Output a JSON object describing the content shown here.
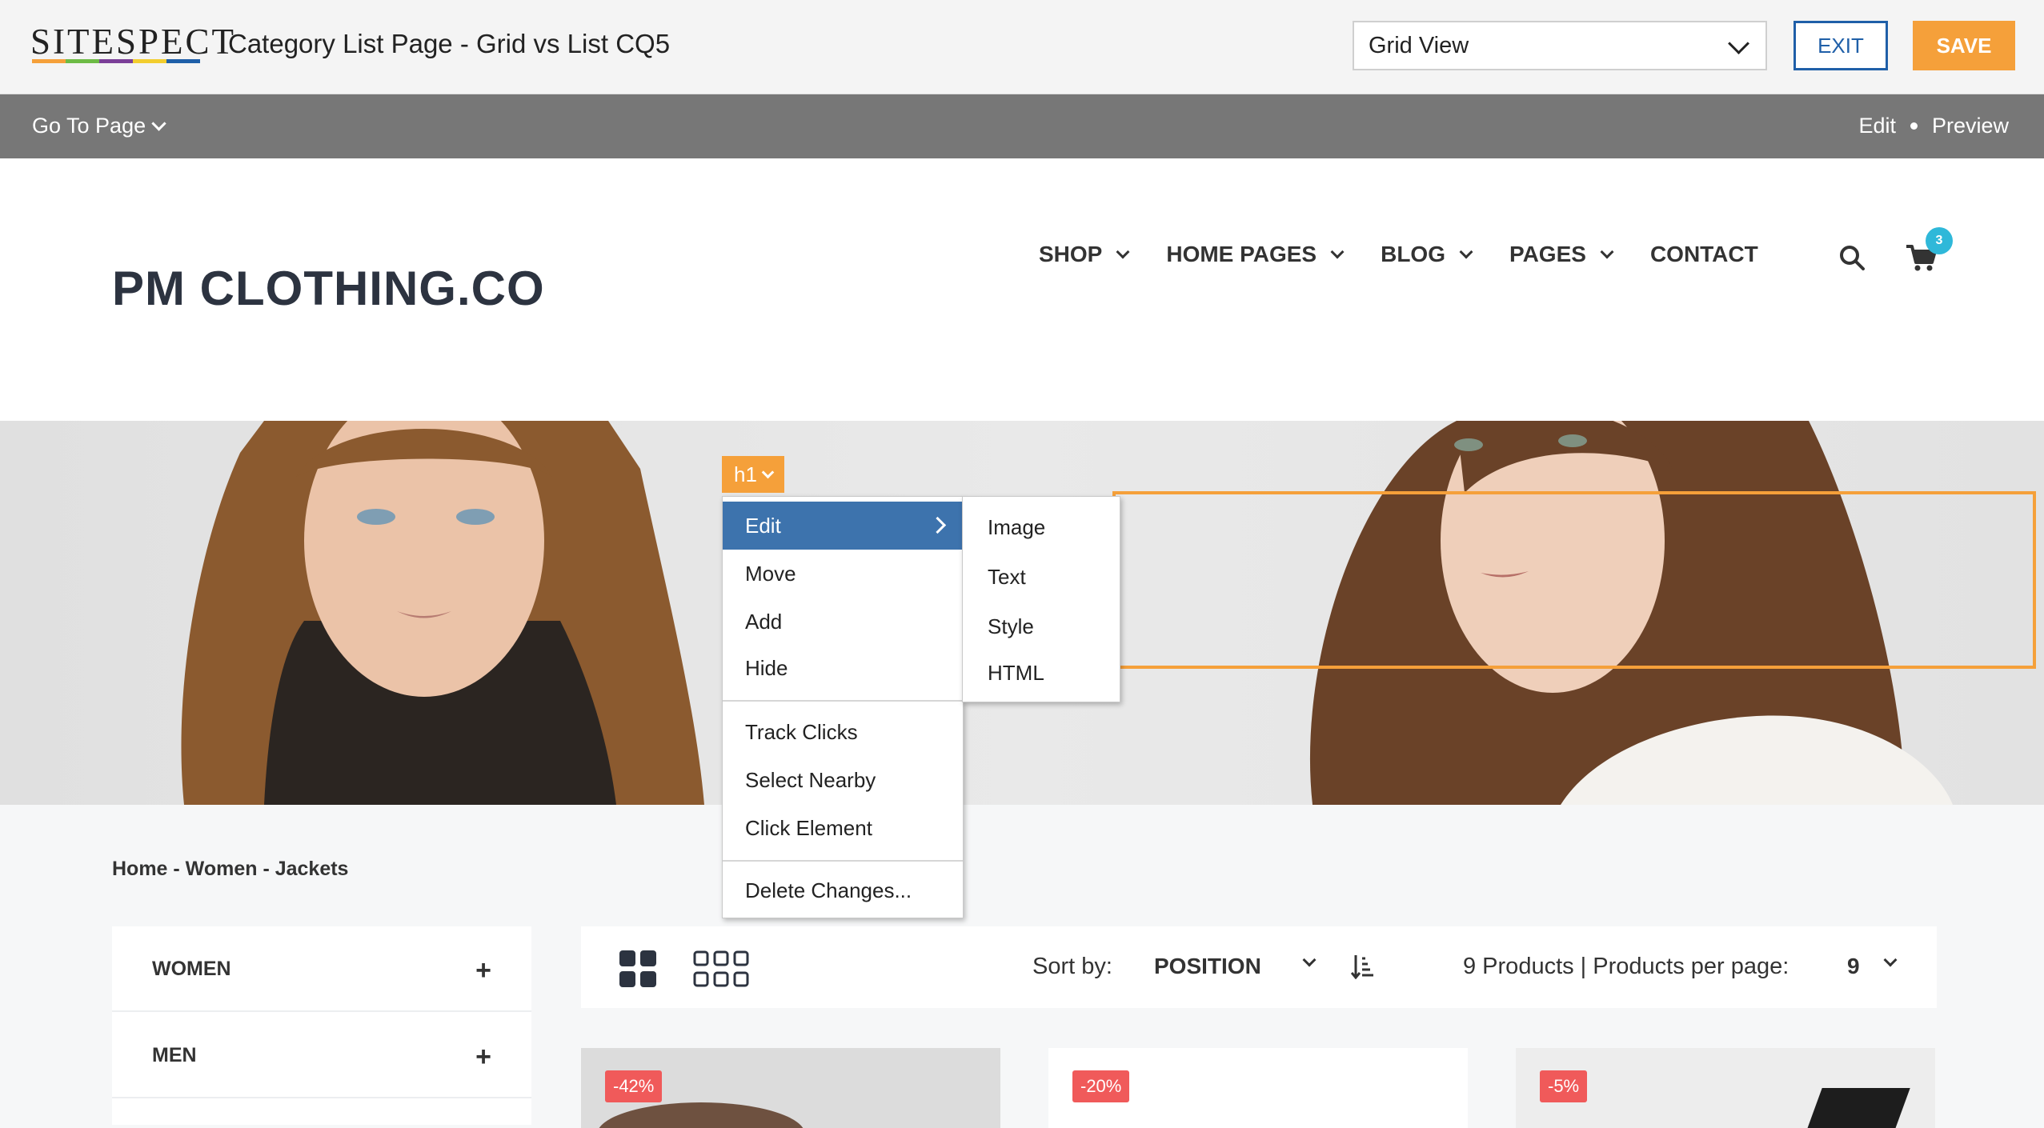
{
  "sitespect": {
    "logo_text": "SITESPECT",
    "logo_colors": [
      "#f5a03a",
      "#6dbb45",
      "#7b3f98",
      "#f2cd2e",
      "#1f5fa8"
    ],
    "project_title": "Category List Page - Grid vs List CQ5",
    "view_select": "Grid View",
    "exit_label": "EXIT",
    "save_label": "SAVE",
    "accent_color": "#f5a03a",
    "primary_color": "#1f5fa8"
  },
  "subbar": {
    "goto_label": "Go To Page",
    "mode_edit": "Edit",
    "mode_preview": "Preview"
  },
  "site": {
    "logo": "PM CLOTHING.CO",
    "nav": [
      "SHOP",
      "HOME PAGES",
      "BLOG",
      "PAGES",
      "CONTACT"
    ],
    "cart_count": "3"
  },
  "editor": {
    "tag_label": "h1",
    "menu": {
      "edit": "Edit",
      "move": "Move",
      "add": "Add",
      "hide": "Hide",
      "track_clicks": "Track Clicks",
      "select_nearby": "Select Nearby",
      "click_element": "Click Element",
      "delete_changes": "Delete Changes..."
    },
    "submenu": {
      "image": "Image",
      "text": "Text",
      "style": "Style",
      "html": "HTML"
    }
  },
  "breadcrumb": "Home - Women - Jackets",
  "sidebar": {
    "categories": [
      "WOMEN",
      "MEN"
    ]
  },
  "toolbar": {
    "sort_label": "Sort by:",
    "sort_value": "POSITION",
    "products_text": "9 Products | Products per page:",
    "per_page": "9"
  },
  "products": {
    "badges": [
      "-42%",
      "-20%",
      "-5%"
    ]
  }
}
